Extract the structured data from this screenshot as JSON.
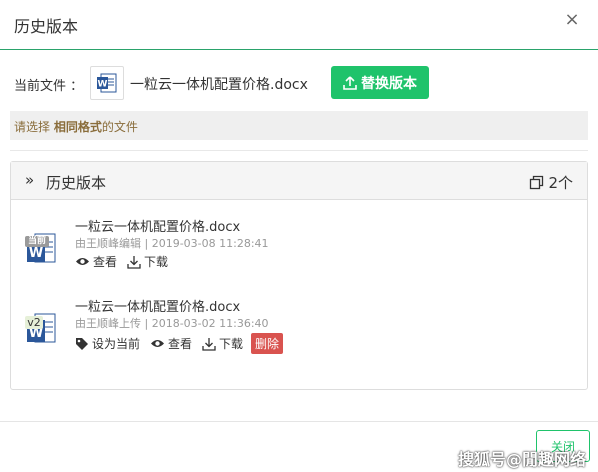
{
  "dialog": {
    "title": "历史版本",
    "close_glyph": "×"
  },
  "current": {
    "label": "当前文件 ：",
    "filename": "一粒云一体机配置价格.docx",
    "replace_label": "替换版本"
  },
  "notice": {
    "prefix": "请选择 ",
    "emphasis": "相同格式",
    "suffix": "的文件"
  },
  "panel": {
    "chevron": "»",
    "title": "历史版本",
    "count": "2个"
  },
  "versions": [
    {
      "badge": "当前",
      "name": "一粒云一体机配置价格.docx",
      "meta": "由王顺峰编辑 | 2019-03-08 11:28:41",
      "view_label": "查看",
      "download_label": "下载"
    },
    {
      "badge": "v2",
      "name": "一粒云一体机配置价格.docx",
      "meta": "由王顺峰上传 | 2018-03-02 11:36:40",
      "set_current_label": "设为当前",
      "view_label": "查看",
      "download_label": "下载",
      "delete_label": "删除"
    }
  ],
  "footer": {
    "close_label": "关闭"
  },
  "watermark": "搜狐号@閒趣网络",
  "colors": {
    "accent": "#1fc36b",
    "danger": "#d9534f",
    "word_blue": "#2b579a"
  }
}
